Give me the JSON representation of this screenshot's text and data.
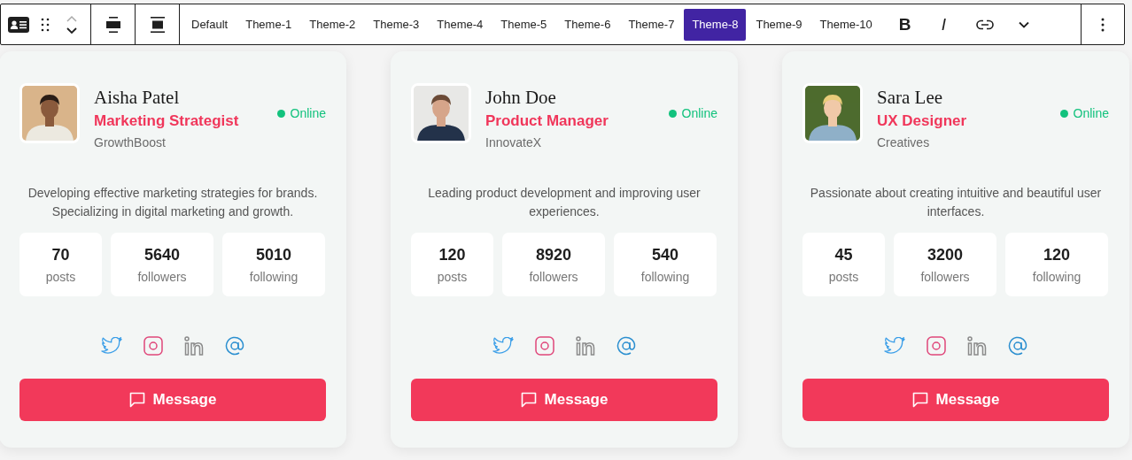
{
  "toolbar": {
    "themes": [
      {
        "label": "Default",
        "selected": false
      },
      {
        "label": "Theme-1",
        "selected": false
      },
      {
        "label": "Theme-2",
        "selected": false
      },
      {
        "label": "Theme-3",
        "selected": false
      },
      {
        "label": "Theme-4",
        "selected": false
      },
      {
        "label": "Theme-5",
        "selected": false
      },
      {
        "label": "Theme-6",
        "selected": false
      },
      {
        "label": "Theme-7",
        "selected": false
      },
      {
        "label": "Theme-8",
        "selected": true
      },
      {
        "label": "Theme-9",
        "selected": false
      },
      {
        "label": "Theme-10",
        "selected": false
      }
    ],
    "bold": "B",
    "italic": "I"
  },
  "cards": [
    {
      "name": "Aisha Patel",
      "role": "Marketing Strategist",
      "company": "GrowthBoost",
      "status": "Online",
      "online": true,
      "bio": "Developing effective marketing strategies for brands. Specializing in digital marketing and growth.",
      "stats": [
        {
          "value": "70",
          "label": "posts"
        },
        {
          "value": "5640",
          "label": "followers"
        },
        {
          "value": "5010",
          "label": "following"
        }
      ],
      "button": "Message"
    },
    {
      "name": "John Doe",
      "role": "Product Manager",
      "company": "InnovateX",
      "status": "Online",
      "online": true,
      "bio": "Leading product development and improving user experiences.",
      "stats": [
        {
          "value": "120",
          "label": "posts"
        },
        {
          "value": "8920",
          "label": "followers"
        },
        {
          "value": "540",
          "label": "following"
        }
      ],
      "button": "Message"
    },
    {
      "name": "Sara Lee",
      "role": "UX Designer",
      "company": "Creatives",
      "status": "Online",
      "online": true,
      "bio": "Passionate about creating intuitive and beautiful user interfaces.",
      "stats": [
        {
          "value": "45",
          "label": "posts"
        },
        {
          "value": "3200",
          "label": "followers"
        },
        {
          "value": "120",
          "label": "following"
        }
      ],
      "button": "Message"
    }
  ]
}
